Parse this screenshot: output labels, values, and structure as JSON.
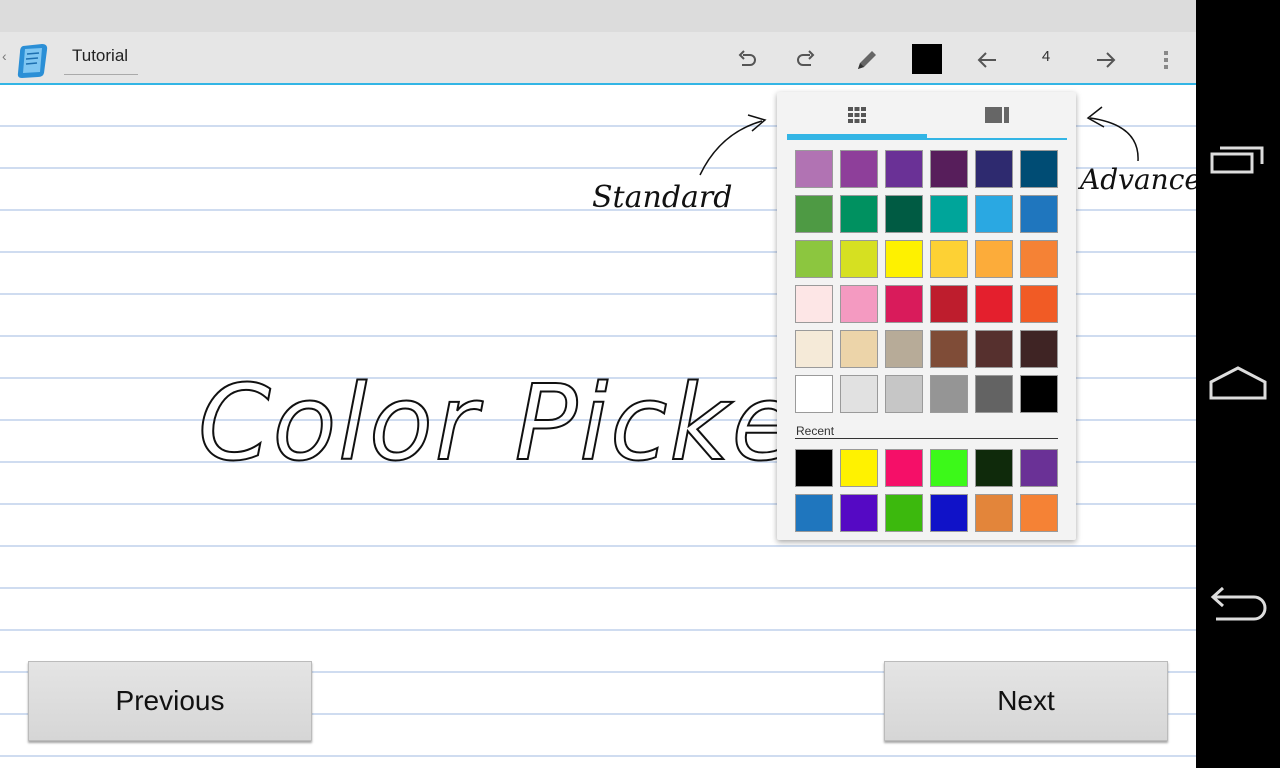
{
  "actionbar": {
    "title": "Tutorial",
    "page_number": "4"
  },
  "icons": {
    "app": "notebook-app-icon",
    "undo": "undo-icon",
    "redo": "redo-icon",
    "pen": "pen-icon",
    "prev_page": "arrow-left-icon",
    "next_page": "arrow-right-icon",
    "overflow": "overflow-menu-icon",
    "standard_tab": "grid-icon",
    "advanced_tab": "advanced-picker-icon"
  },
  "canvas": {
    "handwritten_title": "Color Picker",
    "annotation_standard": "Standard",
    "annotation_advanced": "Advanced"
  },
  "current_color": "#000000",
  "color_picker": {
    "active_tab": "standard",
    "standard_colors": [
      [
        "#b173b3",
        "#8e3f9a",
        "#6a3196",
        "#571e5b",
        "#2e2a6f",
        "#004c74"
      ],
      [
        "#4e9a44",
        "#009160",
        "#005b43",
        "#00a59a",
        "#2aa8e2",
        "#1f76be"
      ],
      [
        "#8cc63f",
        "#d6e021",
        "#fef100",
        "#fdd134",
        "#fcac3a",
        "#f58235"
      ],
      [
        "#fde6e6",
        "#f49ac1",
        "#d91b5b",
        "#be1d2d",
        "#e41f2d",
        "#f15b25"
      ],
      [
        "#f5ead8",
        "#ecd4a9",
        "#b7ab98",
        "#7f4c37",
        "#56302e",
        "#3f2424"
      ],
      [
        "#ffffff",
        "#e1e1e1",
        "#c6c6c6",
        "#959595",
        "#636363",
        "#000000"
      ]
    ],
    "recent_label": "Recent",
    "recent_colors": [
      [
        "#000000",
        "#fff200",
        "#f50f68",
        "#3cf919",
        "#0f2a0b",
        "#6a3196"
      ],
      [
        "#1f76be",
        "#5509c4",
        "#3cb90d",
        "#1012c8",
        "#e3853a",
        "#f58235"
      ]
    ]
  },
  "buttons": {
    "previous": "Previous",
    "next": "Next"
  },
  "system_nav": {
    "recents": "recent-apps-icon",
    "home": "home-icon",
    "back": "back-icon"
  }
}
